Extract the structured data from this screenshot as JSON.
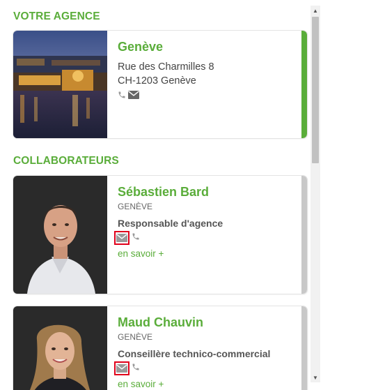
{
  "agency": {
    "section_title": "VOTRE AGENCE",
    "name": "Genève",
    "address_line1": "Rue des Charmilles 8",
    "address_line2": "CH-1203 Genève",
    "accent_color": "#5aad3a",
    "icons": [
      "phone-icon",
      "mail-icon"
    ]
  },
  "collaborators": {
    "section_title": "COLLABORATEURS",
    "people": [
      {
        "name": "Sébastien Bard",
        "city": "GENÈVE",
        "role": "Responsable d'agence",
        "more": "en savoir +",
        "icons": [
          "mail-icon",
          "phone-icon"
        ]
      },
      {
        "name": "Maud Chauvin",
        "city": "GENÈVE",
        "role": "Conseillère technico-commercial",
        "more": "en savoir +",
        "icons": [
          "mail-icon",
          "phone-icon"
        ]
      }
    ],
    "accent_color": "#c8c8c8",
    "highlight_color": "#e0001b"
  }
}
